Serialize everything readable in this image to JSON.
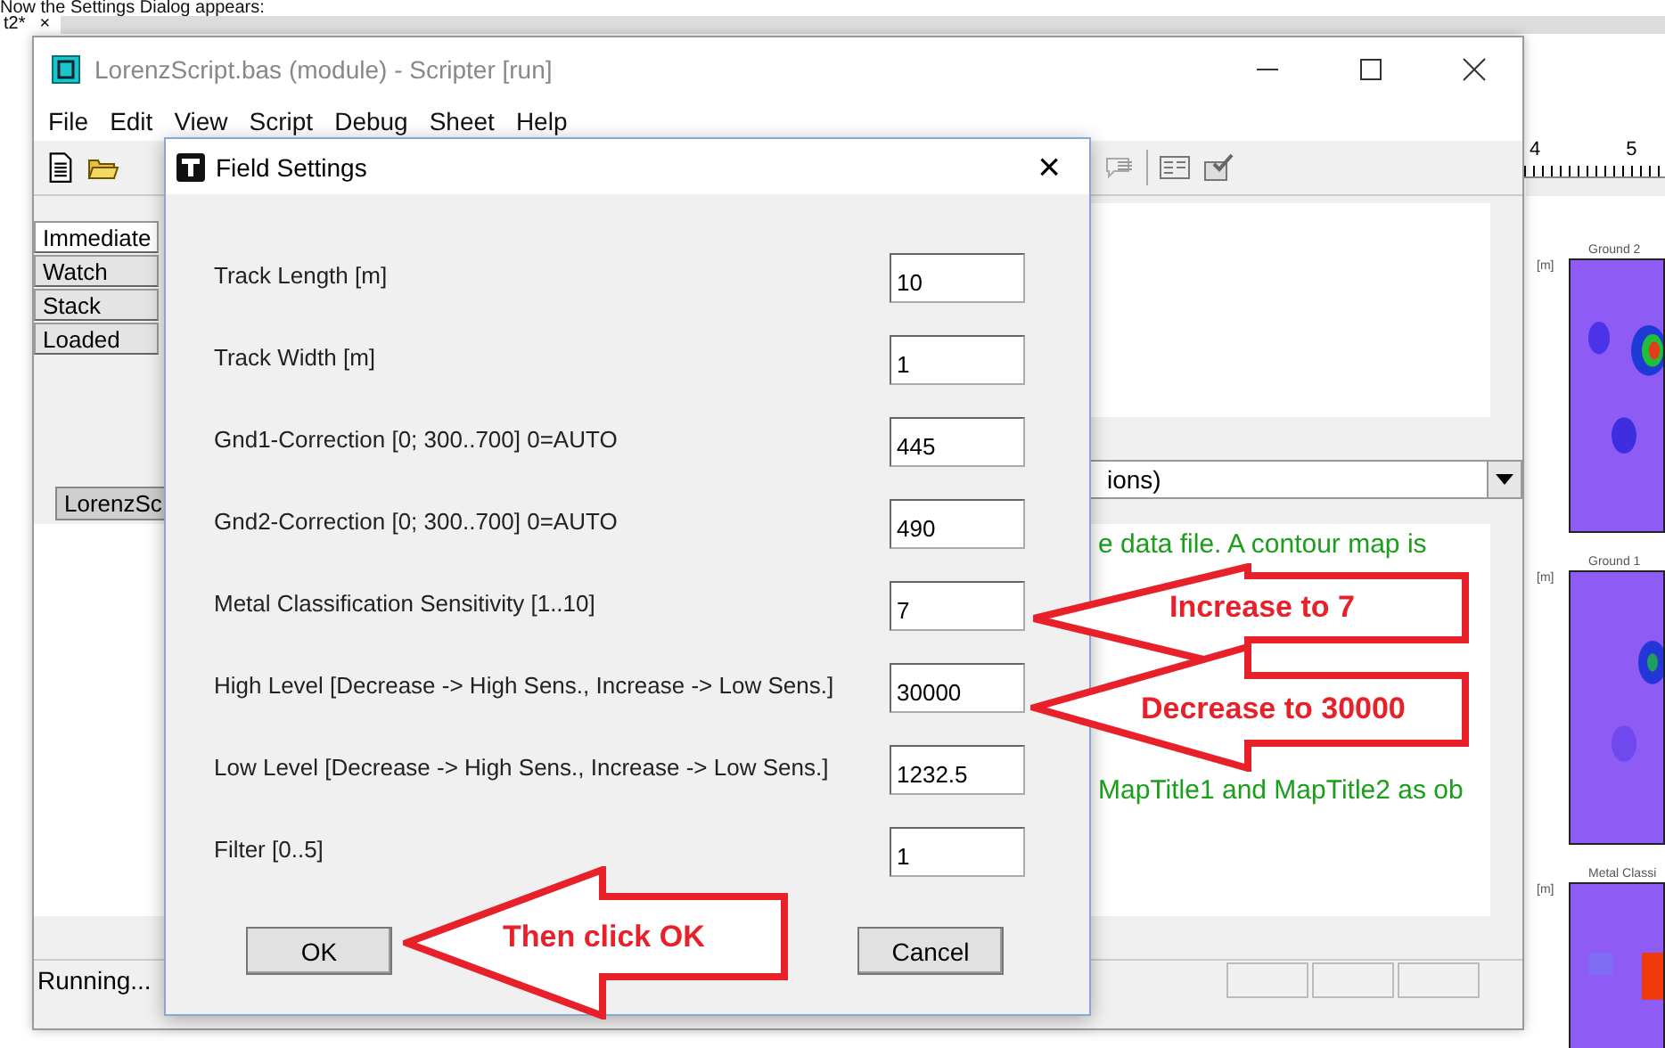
{
  "caption": "Now the Settings Dialog appears:",
  "doc_tab": {
    "label": "t2*",
    "close": "×"
  },
  "window": {
    "title": "LorenzScript.bas (module) - Scripter [run]"
  },
  "menu": [
    "File",
    "Edit",
    "View",
    "Script",
    "Debug",
    "Sheet",
    "Help"
  ],
  "debug_tabs": [
    {
      "label": "Immediate",
      "selected": true
    },
    {
      "label": "Watch",
      "selected": false
    },
    {
      "label": "Stack",
      "selected": false
    },
    {
      "label": "Loaded",
      "selected": false
    }
  ],
  "module_tab": "LorenzSc",
  "proc_dropdown": "ions)",
  "code_lines": [
    "e data file.  A contour map is",
    "MapTitle1 and MapTitle2 as ob"
  ],
  "status": "Running...",
  "ruler_labels": [
    "4",
    "5"
  ],
  "maps": [
    {
      "title": "Ground 2",
      "axis": "[m]"
    },
    {
      "title": "Ground 1",
      "axis": "[m]"
    },
    {
      "title": "Metal Classi",
      "axis": "[m]"
    }
  ],
  "dialog": {
    "title": "Field Settings",
    "close": "×",
    "fields": [
      {
        "label": "Track Length [m]",
        "value": "10"
      },
      {
        "label": "Track Width [m]",
        "value": "1"
      },
      {
        "label": "Gnd1-Correction [0; 300..700]  0=AUTO",
        "value": "445"
      },
      {
        "label": "Gnd2-Correction [0; 300..700]  0=AUTO",
        "value": "490"
      },
      {
        "label": "Metal Classification Sensitivity [1..10]",
        "value": "7"
      },
      {
        "label": "High Level  [Decrease -> High Sens., Increase -> Low Sens.]",
        "value": "30000"
      },
      {
        "label": "Low Level   [Decrease -> High Sens., Increase -> Low Sens.]",
        "value": "1232.5"
      },
      {
        "label": "Filter   [0..5]",
        "value": "1"
      }
    ],
    "buttons": [
      "OK",
      "Cancel"
    ]
  },
  "callouts": [
    {
      "text": "Increase to 7"
    },
    {
      "text": "Decrease to 30000"
    },
    {
      "text": "Then click OK"
    }
  ]
}
